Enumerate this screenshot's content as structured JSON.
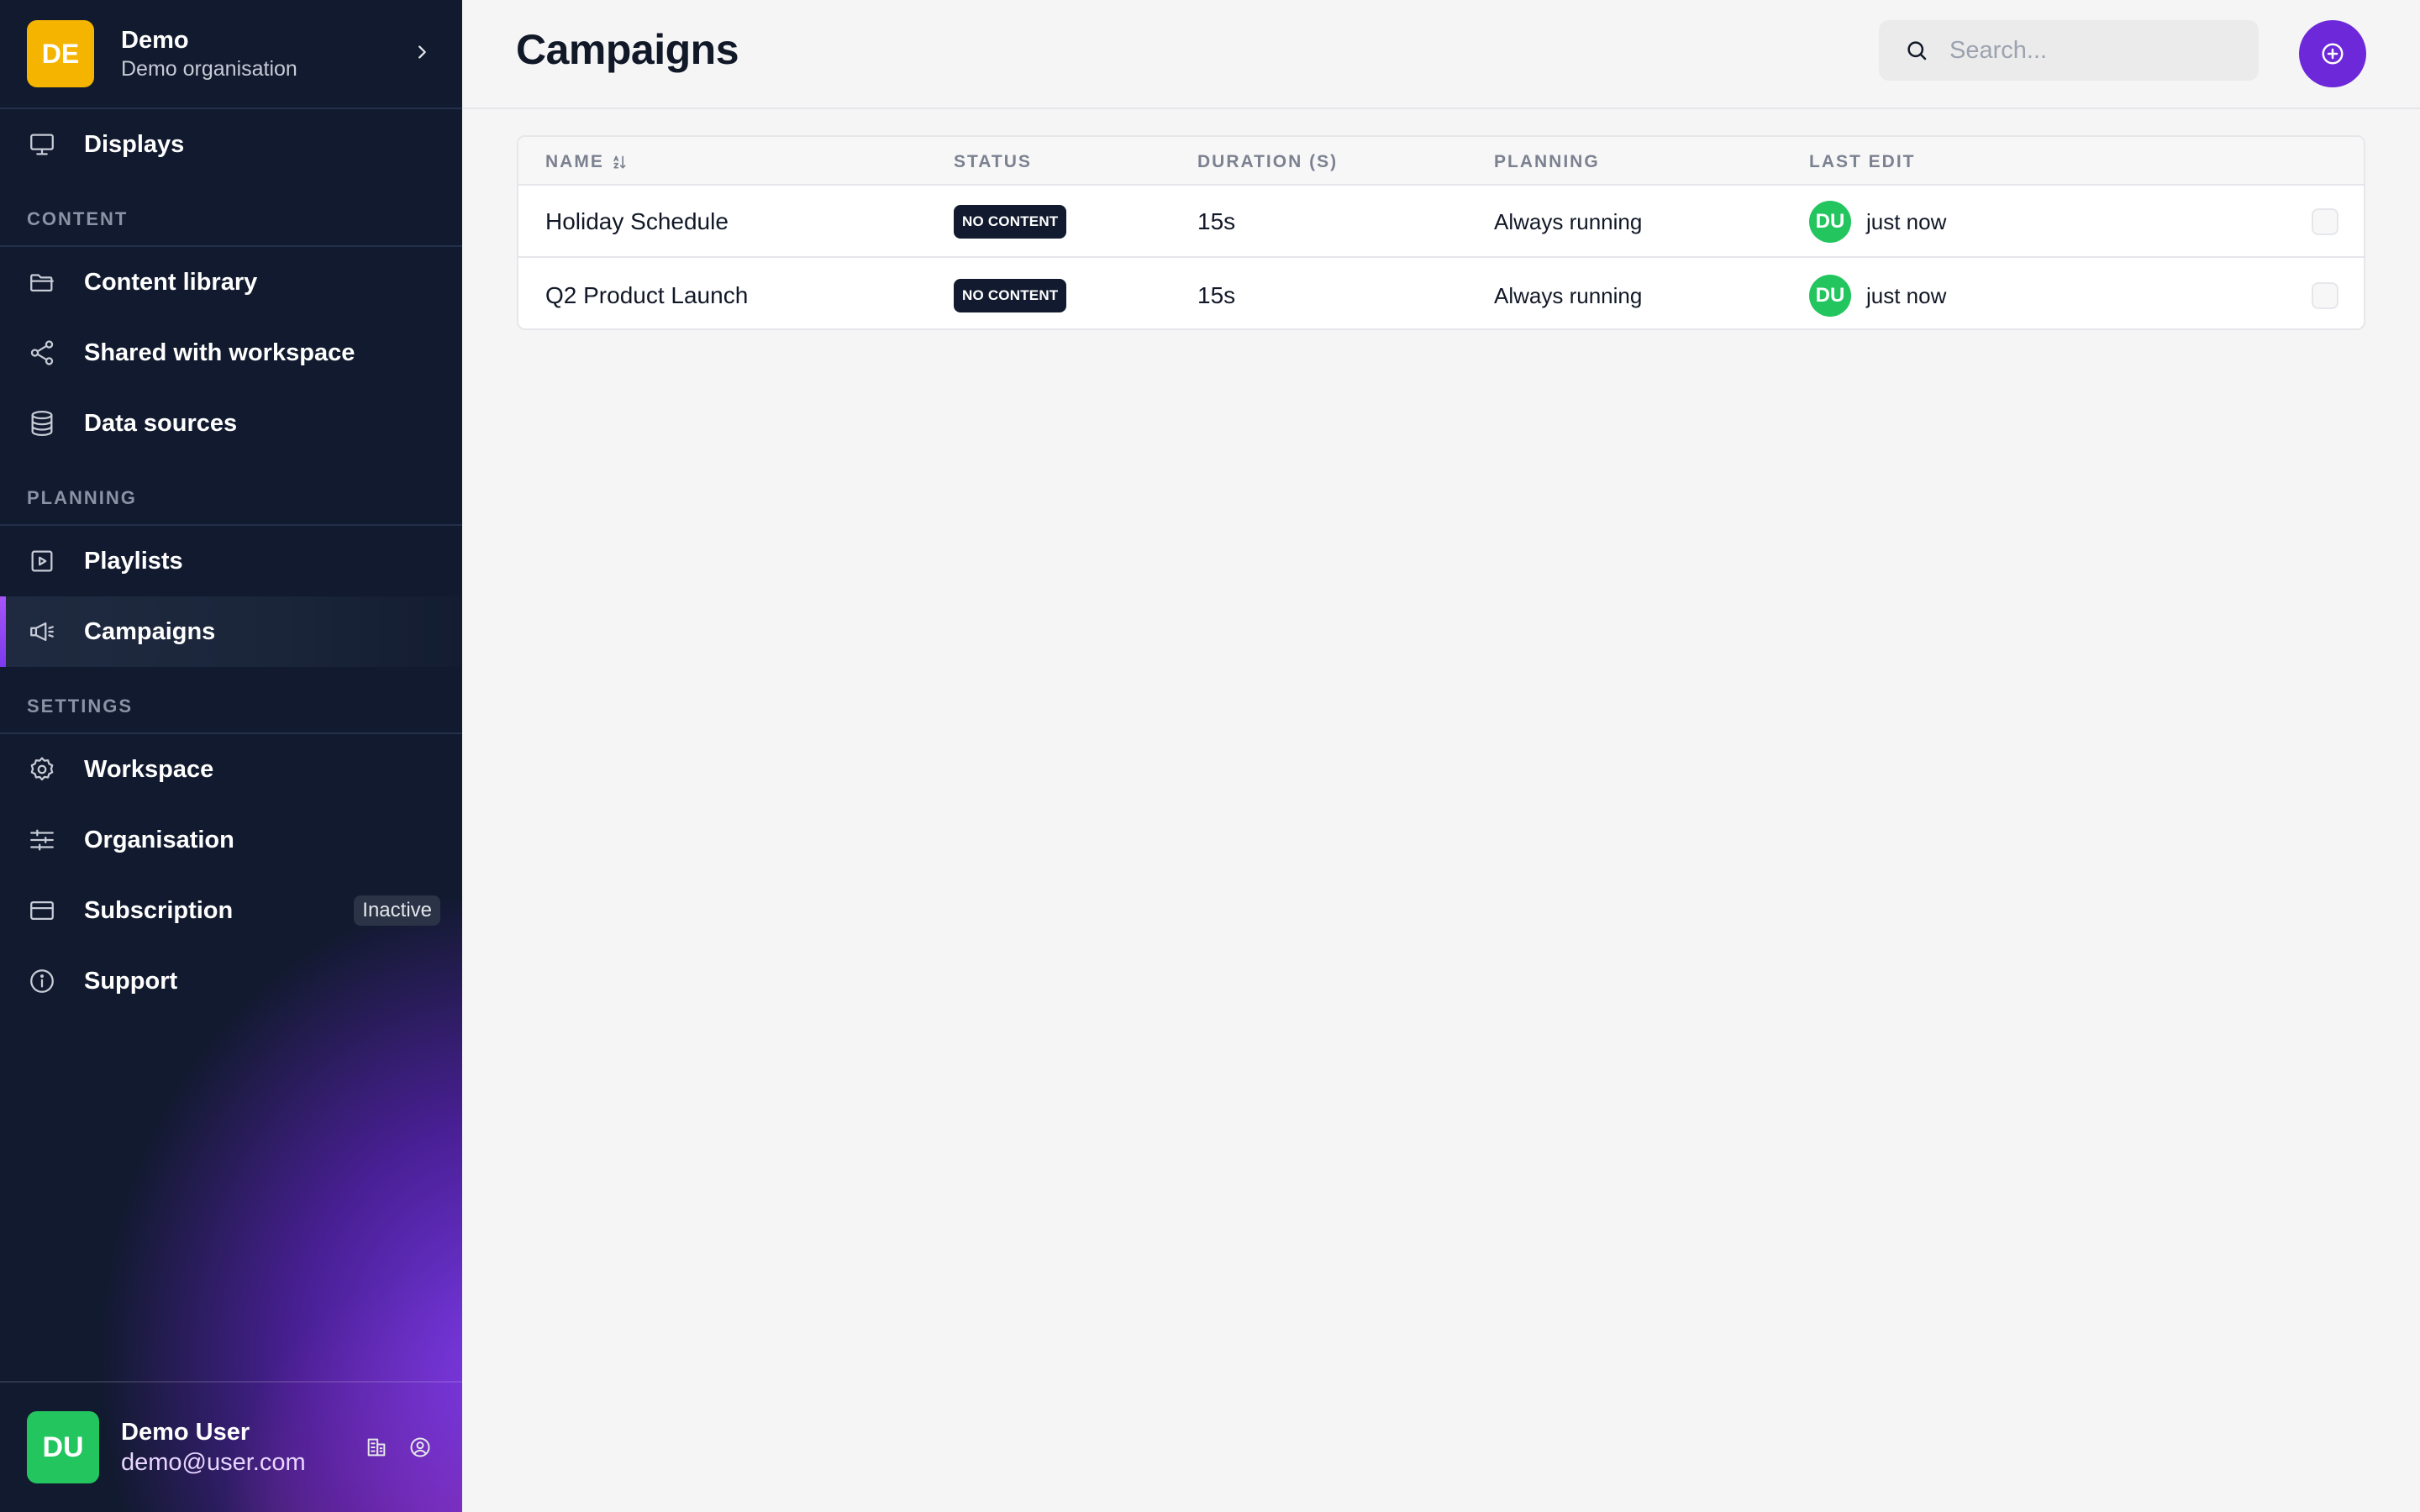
{
  "org": {
    "initials": "DE",
    "name": "Demo",
    "subtitle": "Demo organisation"
  },
  "sidebar": {
    "top_item": {
      "label": "Displays",
      "icon": "monitor-icon"
    },
    "sections": [
      {
        "label": "CONTENT",
        "items": [
          {
            "label": "Content library",
            "icon": "folder-icon"
          },
          {
            "label": "Shared with workspace",
            "icon": "share-icon"
          },
          {
            "label": "Data sources",
            "icon": "database-icon"
          }
        ]
      },
      {
        "label": "PLANNING",
        "items": [
          {
            "label": "Playlists",
            "icon": "play-square-icon"
          },
          {
            "label": "Campaigns",
            "icon": "megaphone-icon",
            "active": true
          }
        ]
      },
      {
        "label": "SETTINGS",
        "items": [
          {
            "label": "Workspace",
            "icon": "gear-icon"
          },
          {
            "label": "Organisation",
            "icon": "sliders-icon"
          },
          {
            "label": "Subscription",
            "icon": "card-icon",
            "badge": "Inactive"
          },
          {
            "label": "Support",
            "icon": "info-icon"
          }
        ]
      }
    ]
  },
  "user": {
    "initials": "DU",
    "name": "Demo User",
    "email": "demo@user.com"
  },
  "header": {
    "title": "Campaigns",
    "search_placeholder": "Search..."
  },
  "table": {
    "columns": [
      "NAME",
      "STATUS",
      "DURATION (S)",
      "PLANNING",
      "LAST EDIT"
    ],
    "rows": [
      {
        "name": "Holiday Schedule",
        "status": "NO CONTENT",
        "duration": "15s",
        "planning": "Always running",
        "editor": "DU",
        "last_edit": "just now"
      },
      {
        "name": "Q2 Product Launch",
        "status": "NO CONTENT",
        "duration": "15s",
        "planning": "Always running",
        "editor": "DU",
        "last_edit": "just now"
      }
    ]
  },
  "colors": {
    "sidebar_bg": "#111a2e",
    "accent": "#6d28d9",
    "org_avatar": "#f5b400",
    "user_avatar": "#22c55e"
  }
}
